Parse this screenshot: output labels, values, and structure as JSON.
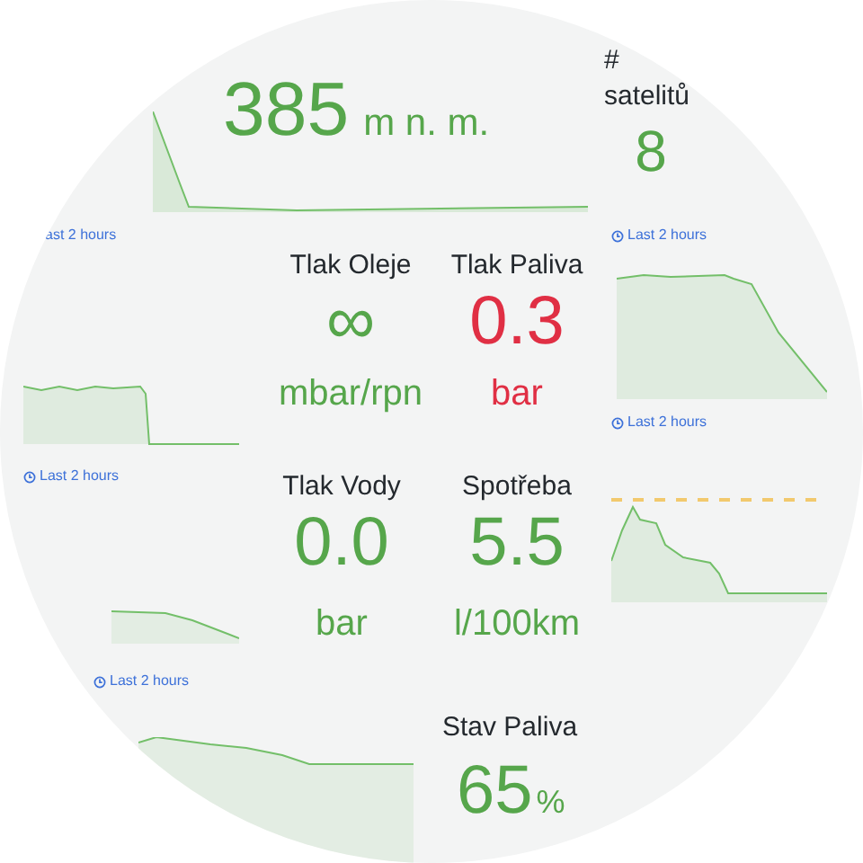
{
  "altitude": {
    "value": "385",
    "unit": "m n. m."
  },
  "satellites": {
    "title_lines": [
      "#",
      "satelitů"
    ],
    "value": "8"
  },
  "time_ranges": [
    {
      "text": "ast 2 hours",
      "icon": false
    },
    {
      "text": "Last 2 hours",
      "icon": true
    },
    {
      "text": "Last 2 hours",
      "icon": true
    },
    {
      "text": "Last 2 hours",
      "icon": true
    },
    {
      "text": "Last 2 hours",
      "icon": true
    }
  ],
  "stats": [
    {
      "title": "Tlak Oleje",
      "value": "∞",
      "unit": "mbar/rpn",
      "color": "#56a64b"
    },
    {
      "title": "Tlak Paliva",
      "value": "0.3",
      "unit": "bar",
      "color": "#e02f44"
    },
    {
      "title": "Tlak Vody",
      "value": "0.0",
      "unit": "bar",
      "color": "#56a64b"
    },
    {
      "title": "Spotřeba",
      "value": "5.5",
      "unit": "l/100km",
      "color": "#56a64b"
    }
  ],
  "fuel_level": {
    "title": "Stav Paliva",
    "value": "65",
    "unit": "%"
  }
}
